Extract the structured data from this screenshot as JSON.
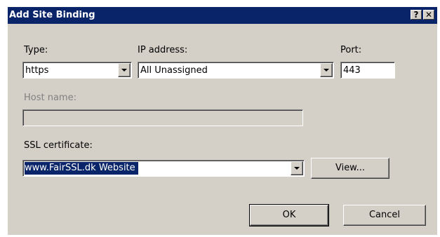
{
  "window": {
    "title": "Add Site Binding",
    "help_button": "?",
    "close_button": "✕"
  },
  "form": {
    "type": {
      "label": "Type:",
      "value": "https"
    },
    "ip_address": {
      "label": "IP address:",
      "value": "All Unassigned"
    },
    "port": {
      "label": "Port:",
      "value": "443"
    },
    "host_name": {
      "label": "Host name:",
      "value": "",
      "enabled": false
    },
    "ssl_certificate": {
      "label": "SSL certificate:",
      "value": "www.FairSSL.dk Website"
    }
  },
  "buttons": {
    "view": "View...",
    "ok": "OK",
    "cancel": "Cancel"
  },
  "colors": {
    "title_bar": "#0a246a",
    "dialog_face": "#d4d0c8",
    "selection": "#0a246a",
    "disabled_text": "#808080"
  }
}
